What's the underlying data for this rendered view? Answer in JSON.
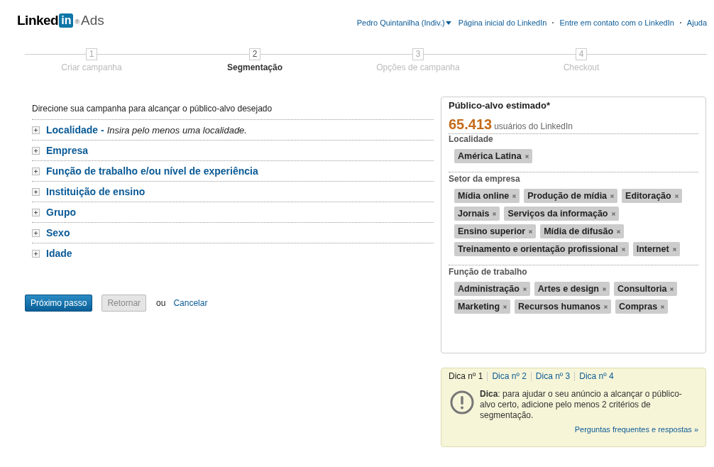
{
  "logo": {
    "word": "Linked",
    "badge": "in",
    "mark": "®",
    "product": "Ads"
  },
  "top_nav": [
    {
      "label": "Pedro Quintanilha (Indiv.)",
      "dropdown": true
    },
    {
      "label": "Página inicial do LinkedIn",
      "dropdown": false
    },
    {
      "label": "Entre em contato com o LinkedIn",
      "dropdown": false
    },
    {
      "label": "Ajuda",
      "dropdown": false
    }
  ],
  "steps": [
    {
      "number": "1",
      "label": "Criar campanha",
      "selected": false
    },
    {
      "number": "2",
      "label": "Segmentação",
      "selected": true
    },
    {
      "number": "3",
      "label": "Opções de campanha",
      "selected": false
    },
    {
      "number": "4",
      "label": "Checkout",
      "selected": false
    }
  ],
  "intro": "Direcione sua campanha para alcançar o público-alvo desejado",
  "sections": [
    {
      "title": "Localidade -",
      "hint": "Insira pelo menos uma localidade.",
      "expanded": false
    },
    {
      "title": "Empresa",
      "expanded": false
    },
    {
      "title": "Função de trabalho e/ou nível de experiência",
      "expanded": false
    },
    {
      "title": "Instituição de ensino",
      "expanded": false
    },
    {
      "title": "Grupo",
      "expanded": false
    },
    {
      "title": "Sexo",
      "expanded": false
    },
    {
      "title": "Idade",
      "expanded": false
    }
  ],
  "actions": {
    "next": "Próximo passo",
    "back": "Retornar",
    "or": "ou",
    "cancel": "Cancelar"
  },
  "audience": {
    "title": "Público-alvo estimado*",
    "count": "65.413",
    "count_label": "usuários do LinkedIn",
    "groups": [
      {
        "label": "Localidade",
        "tags": [
          "América Latina"
        ]
      },
      {
        "label": "Setor da empresa",
        "tags": [
          "Mídia online",
          "Produção de mídia",
          "Editoração",
          "Jornais",
          "Serviços da informação",
          "Ensino superior",
          "Mídia de difusão",
          "Treinamento e orientação profissional",
          "Internet"
        ]
      },
      {
        "label": "Função de trabalho",
        "tags": [
          "Administração",
          "Artes e design",
          "Consultoria",
          "Marketing",
          "Recursos humanos",
          "Compras"
        ]
      }
    ]
  },
  "tips": {
    "tabs": [
      {
        "label": "Dica nº 1",
        "selected": true
      },
      {
        "label": "Dica nº 2",
        "selected": false
      },
      {
        "label": "Dica nº 3",
        "selected": false
      },
      {
        "label": "Dica nº 4",
        "selected": false
      }
    ],
    "text": "**Dica**: para ajudar o seu anúncio a alcançar o público-alvo certo, adicione pelo menos 2 critérios de segmentação.",
    "link": "Perguntas frequentes e respostas »"
  }
}
